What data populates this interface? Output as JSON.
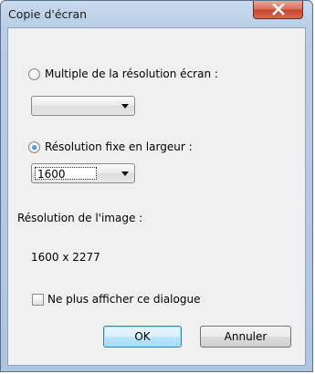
{
  "window": {
    "title": "Copie d'écran"
  },
  "options": {
    "multiple_label": "Multiple de la résolution écran :",
    "multiple_selected": false,
    "multiple_value": "",
    "fixed_label": "Résolution fixe en largeur :",
    "fixed_selected": true,
    "fixed_value": "1600"
  },
  "resolution": {
    "label": "Résolution de l'image :",
    "value": "1600 x 2277"
  },
  "dont_show": {
    "label": "Ne plus afficher ce dialogue",
    "checked": false
  },
  "buttons": {
    "ok": "OK",
    "cancel": "Annuler"
  },
  "icons": {
    "close": "close-icon",
    "dropdown": "chevron-down-icon"
  },
  "colors": {
    "titlebar": "#b9cde6",
    "close_button": "#c64431",
    "client_bg": "#f0f0f0",
    "radio_checked": "#1e6fc0"
  }
}
